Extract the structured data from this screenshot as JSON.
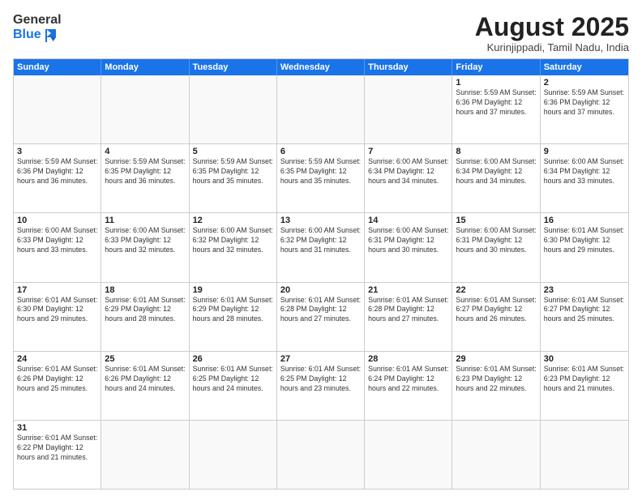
{
  "header": {
    "logo_general": "General",
    "logo_blue": "Blue",
    "title": "August 2025",
    "subtitle": "Kurinjippadi, Tamil Nadu, India"
  },
  "days_of_week": [
    "Sunday",
    "Monday",
    "Tuesday",
    "Wednesday",
    "Thursday",
    "Friday",
    "Saturday"
  ],
  "weeks": [
    [
      {
        "num": "",
        "info": ""
      },
      {
        "num": "",
        "info": ""
      },
      {
        "num": "",
        "info": ""
      },
      {
        "num": "",
        "info": ""
      },
      {
        "num": "",
        "info": ""
      },
      {
        "num": "1",
        "info": "Sunrise: 5:59 AM\nSunset: 6:36 PM\nDaylight: 12 hours and 37 minutes."
      },
      {
        "num": "2",
        "info": "Sunrise: 5:59 AM\nSunset: 6:36 PM\nDaylight: 12 hours and 37 minutes."
      }
    ],
    [
      {
        "num": "3",
        "info": "Sunrise: 5:59 AM\nSunset: 6:36 PM\nDaylight: 12 hours and 36 minutes."
      },
      {
        "num": "4",
        "info": "Sunrise: 5:59 AM\nSunset: 6:35 PM\nDaylight: 12 hours and 36 minutes."
      },
      {
        "num": "5",
        "info": "Sunrise: 5:59 AM\nSunset: 6:35 PM\nDaylight: 12 hours and 35 minutes."
      },
      {
        "num": "6",
        "info": "Sunrise: 5:59 AM\nSunset: 6:35 PM\nDaylight: 12 hours and 35 minutes."
      },
      {
        "num": "7",
        "info": "Sunrise: 6:00 AM\nSunset: 6:34 PM\nDaylight: 12 hours and 34 minutes."
      },
      {
        "num": "8",
        "info": "Sunrise: 6:00 AM\nSunset: 6:34 PM\nDaylight: 12 hours and 34 minutes."
      },
      {
        "num": "9",
        "info": "Sunrise: 6:00 AM\nSunset: 6:34 PM\nDaylight: 12 hours and 33 minutes."
      }
    ],
    [
      {
        "num": "10",
        "info": "Sunrise: 6:00 AM\nSunset: 6:33 PM\nDaylight: 12 hours and 33 minutes."
      },
      {
        "num": "11",
        "info": "Sunrise: 6:00 AM\nSunset: 6:33 PM\nDaylight: 12 hours and 32 minutes."
      },
      {
        "num": "12",
        "info": "Sunrise: 6:00 AM\nSunset: 6:32 PM\nDaylight: 12 hours and 32 minutes."
      },
      {
        "num": "13",
        "info": "Sunrise: 6:00 AM\nSunset: 6:32 PM\nDaylight: 12 hours and 31 minutes."
      },
      {
        "num": "14",
        "info": "Sunrise: 6:00 AM\nSunset: 6:31 PM\nDaylight: 12 hours and 30 minutes."
      },
      {
        "num": "15",
        "info": "Sunrise: 6:00 AM\nSunset: 6:31 PM\nDaylight: 12 hours and 30 minutes."
      },
      {
        "num": "16",
        "info": "Sunrise: 6:01 AM\nSunset: 6:30 PM\nDaylight: 12 hours and 29 minutes."
      }
    ],
    [
      {
        "num": "17",
        "info": "Sunrise: 6:01 AM\nSunset: 6:30 PM\nDaylight: 12 hours and 29 minutes."
      },
      {
        "num": "18",
        "info": "Sunrise: 6:01 AM\nSunset: 6:29 PM\nDaylight: 12 hours and 28 minutes."
      },
      {
        "num": "19",
        "info": "Sunrise: 6:01 AM\nSunset: 6:29 PM\nDaylight: 12 hours and 28 minutes."
      },
      {
        "num": "20",
        "info": "Sunrise: 6:01 AM\nSunset: 6:28 PM\nDaylight: 12 hours and 27 minutes."
      },
      {
        "num": "21",
        "info": "Sunrise: 6:01 AM\nSunset: 6:28 PM\nDaylight: 12 hours and 27 minutes."
      },
      {
        "num": "22",
        "info": "Sunrise: 6:01 AM\nSunset: 6:27 PM\nDaylight: 12 hours and 26 minutes."
      },
      {
        "num": "23",
        "info": "Sunrise: 6:01 AM\nSunset: 6:27 PM\nDaylight: 12 hours and 25 minutes."
      }
    ],
    [
      {
        "num": "24",
        "info": "Sunrise: 6:01 AM\nSunset: 6:26 PM\nDaylight: 12 hours and 25 minutes."
      },
      {
        "num": "25",
        "info": "Sunrise: 6:01 AM\nSunset: 6:26 PM\nDaylight: 12 hours and 24 minutes."
      },
      {
        "num": "26",
        "info": "Sunrise: 6:01 AM\nSunset: 6:25 PM\nDaylight: 12 hours and 24 minutes."
      },
      {
        "num": "27",
        "info": "Sunrise: 6:01 AM\nSunset: 6:25 PM\nDaylight: 12 hours and 23 minutes."
      },
      {
        "num": "28",
        "info": "Sunrise: 6:01 AM\nSunset: 6:24 PM\nDaylight: 12 hours and 22 minutes."
      },
      {
        "num": "29",
        "info": "Sunrise: 6:01 AM\nSunset: 6:23 PM\nDaylight: 12 hours and 22 minutes."
      },
      {
        "num": "30",
        "info": "Sunrise: 6:01 AM\nSunset: 6:23 PM\nDaylight: 12 hours and 21 minutes."
      }
    ],
    [
      {
        "num": "31",
        "info": "Sunrise: 6:01 AM\nSunset: 6:22 PM\nDaylight: 12 hours and 21 minutes."
      },
      {
        "num": "",
        "info": ""
      },
      {
        "num": "",
        "info": ""
      },
      {
        "num": "",
        "info": ""
      },
      {
        "num": "",
        "info": ""
      },
      {
        "num": "",
        "info": ""
      },
      {
        "num": "",
        "info": ""
      }
    ]
  ]
}
